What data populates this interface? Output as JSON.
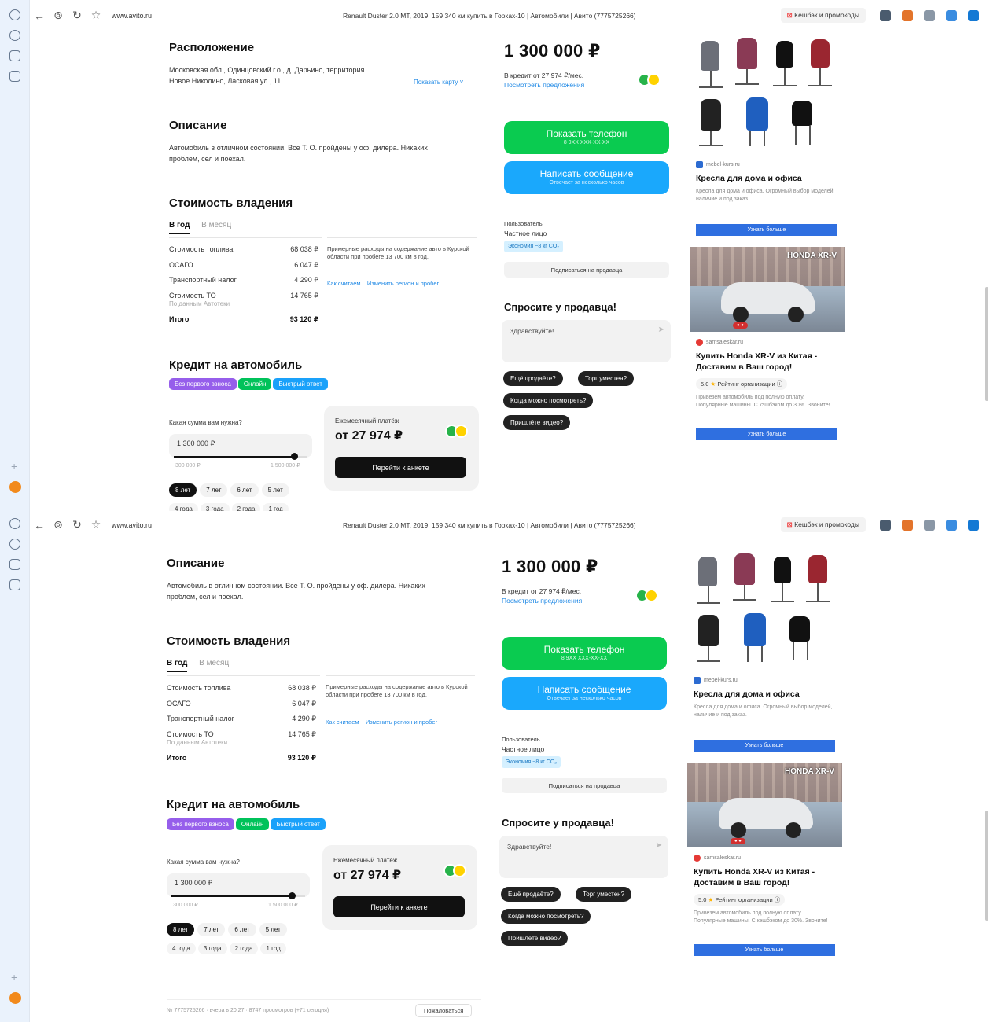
{
  "browser": {
    "url": "www.avito.ru",
    "page_title": "Renault Duster 2.0 MT, 2019, 159 340 км купить в Горках-10 | Автомобили | Авито (7775725266)",
    "cashback": "Кешбэк и промокоды"
  },
  "location": {
    "heading": "Расположение",
    "address_line1": "Московская обл., Одинцовский г.о., д. Дарьино, территория",
    "address_line2": "Новое Николино, Ласковая ул., 11",
    "map_link": "Показать карту ˅"
  },
  "description": {
    "heading": "Описание",
    "line1": "Автомобиль в отличном состоянии. Все Т. О. пройдены у оф. дилера. Никаких",
    "line2": "проблем, сел и поехал."
  },
  "ownership": {
    "heading": "Стоимость владения",
    "tabs": [
      "В год",
      "В месяц"
    ],
    "rows": [
      {
        "label": "Стоимость топлива",
        "value": "68 038 ₽"
      },
      {
        "label": "ОСАГО",
        "value": "6 047 ₽"
      },
      {
        "label": "Транспортный налог",
        "value": "4 290 ₽"
      },
      {
        "label": "Стоимость ТО",
        "value": "14 765 ₽"
      }
    ],
    "to_note": "По данным Автотеки",
    "total_label": "Итого",
    "total_value": "93 120 ₽",
    "note": "Примерные расходы на содержание авто в Курской области при пробеге 13 700 км в год.",
    "link_how": "Как считаем",
    "link_change": "Изменить регион и пробег"
  },
  "loan": {
    "heading": "Кредит на автомобиль",
    "badges": [
      "Без первого взноса",
      "Онлайн",
      "Быстрый ответ"
    ],
    "amount_label": "Какая сумма вам нужна?",
    "amount_value": "1 300 000 ₽",
    "amount_progress": 0.9,
    "min_label": "300 000 ₽",
    "max_label": "1 500 000 ₽",
    "terms": [
      "8 лет",
      "7 лет",
      "6 лет",
      "5 лет"
    ],
    "terms2": [
      "4 года",
      "3 года",
      "2 года",
      "1 год"
    ],
    "payment_label": "Ежемесячный платёж",
    "payment_value": "от 27 974 ₽",
    "go_button": "Перейти к анкете"
  },
  "sidebar": {
    "price": "1 300 000 ₽",
    "credit_line": "В кредит от 27 974 ₽/мес.",
    "credit_link": "Посмотреть предложения",
    "phone_button": "Показать телефон",
    "phone_sub": "8 9XX XXX-XX-XX",
    "message_button": "Написать сообщение",
    "message_sub": "Отвечает за несколько часов",
    "seller_label": "Пользователь",
    "seller_name": "Частное лицо",
    "seller_tag": "Экономия ~8 кг CO₂",
    "subscribe": "Подписаться на продавца",
    "ask_heading": "Спросите у продавца!",
    "message_placeholder": "Здравствуйте!",
    "questions": [
      "Ещё продаёте?",
      "Торг уместен?",
      "Когда можно посмотреть?",
      "Пришлёте видео?"
    ]
  },
  "ads": {
    "ad1": {
      "source": "mebel-kurs.ru",
      "title": "Кресла для дома и офиса",
      "desc": "Кресла для дома и офиса. Огромный выбор моделей, наличие и под заказ.",
      "button": "Узнать больше"
    },
    "ad2": {
      "car_text": "HONDA XR-V",
      "source": "samsaleskar.ru",
      "title": "Купить Honda XR-V из Китая - Доставим в Ваш город!",
      "rating": "5.0",
      "rating_label": "Рейтинг организации",
      "desc": "Привезем автомобиль под полную оплату. Популярные машины. С кэшбэком до 30%. Звоните!",
      "button": "Узнать больше"
    }
  },
  "footer": {
    "text": "№ 7775725266 · вчера в 20:27 · 8747 просмотров (+71 сегодня)",
    "button": "Пожаловаться"
  }
}
